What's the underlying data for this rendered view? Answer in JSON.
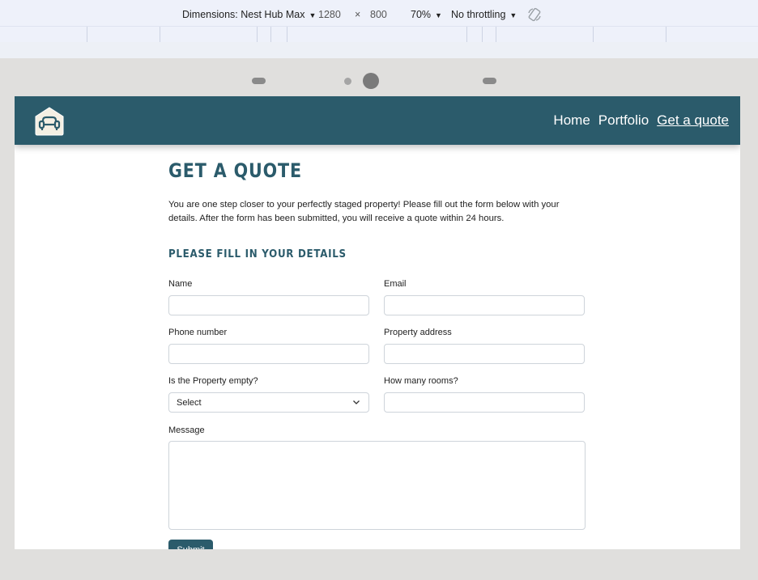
{
  "devtools": {
    "device_label": "Dimensions: Nest Hub Max",
    "width": "1280",
    "times": "×",
    "height": "800",
    "zoom": "70%",
    "throttle": "No throttling"
  },
  "site": {
    "nav": {
      "home": "Home",
      "portfolio": "Portfolio",
      "quote": "Get a quote"
    },
    "title": "GET A QUOTE",
    "intro": "You are one step closer to your perfectly staged property! Please fill out the form below with your details. After the form has been submitted, you will receive a quote within 24 hours.",
    "subtitle": "PLEASE FILL IN YOUR DETAILS",
    "form": {
      "name_label": "Name",
      "email_label": "Email",
      "phone_label": "Phone number",
      "address_label": "Property address",
      "empty_label": "Is the Property empty?",
      "empty_value": "Select",
      "rooms_label": "How many rooms?",
      "message_label": "Message",
      "submit_label": "Submit"
    }
  }
}
